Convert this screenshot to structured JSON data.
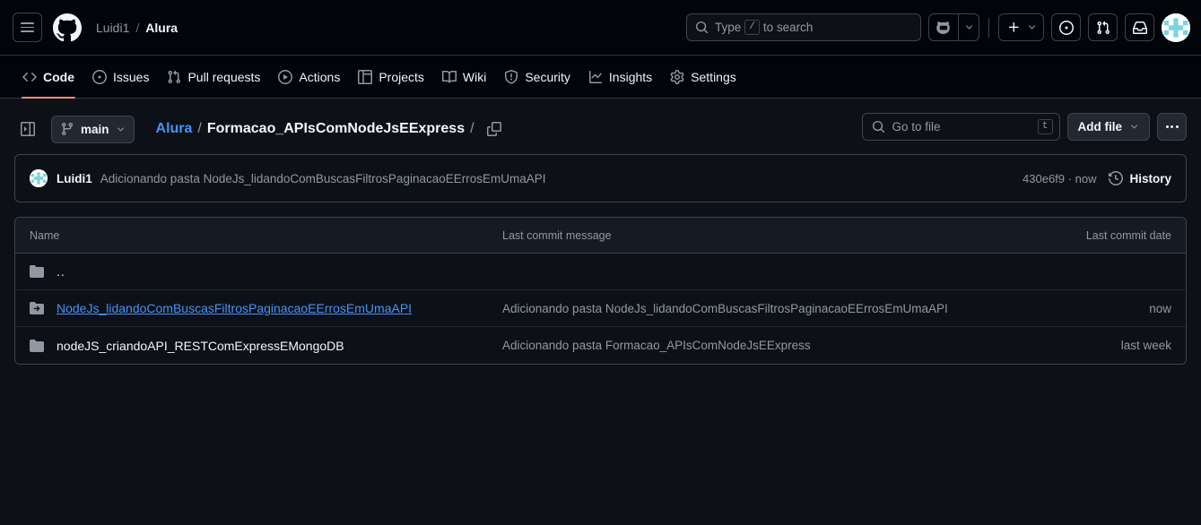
{
  "header": {
    "menu_icon": "hamburger-icon",
    "logo_icon": "github-logo-icon",
    "owner": "Luidi1",
    "separator": "/",
    "repo": "Alura",
    "search": {
      "placeholder_prefix": "Type",
      "kbd": "/",
      "placeholder_suffix": "to search",
      "icon": "search-icon"
    },
    "copilot_icon": "copilot-icon",
    "copilot_caret_icon": "chevron-down-icon",
    "create_new_icon": "plus-icon",
    "create_new_caret_icon": "chevron-down-icon",
    "issues_icon": "issue-opened-icon",
    "pull_requests_icon": "git-pull-request-icon",
    "inbox_icon": "inbox-icon",
    "avatar_icon": "user-avatar"
  },
  "repo_nav": {
    "tabs": [
      {
        "label": "Code",
        "icon": "code-icon",
        "active": true
      },
      {
        "label": "Issues",
        "icon": "issue-opened-icon",
        "active": false
      },
      {
        "label": "Pull requests",
        "icon": "git-pull-request-icon",
        "active": false
      },
      {
        "label": "Actions",
        "icon": "play-icon",
        "active": false
      },
      {
        "label": "Projects",
        "icon": "table-icon",
        "active": false
      },
      {
        "label": "Wiki",
        "icon": "book-icon",
        "active": false
      },
      {
        "label": "Security",
        "icon": "shield-icon",
        "active": false
      },
      {
        "label": "Insights",
        "icon": "graph-icon",
        "active": false
      },
      {
        "label": "Settings",
        "icon": "gear-icon",
        "active": false
      }
    ],
    "active_underline_color": "#fd8c73"
  },
  "browser_bar": {
    "sidebar_toggle_icon": "sidebar-expand-icon",
    "branch": {
      "icon": "git-branch-icon",
      "name": "main",
      "caret_icon": "chevron-down-icon"
    },
    "path": {
      "root": "Alura",
      "sep1": "/",
      "current": "Formacao_APIsComNodeJsEExpress",
      "sep2": "/",
      "copy_icon": "copy-path-icon"
    },
    "go_to_file": {
      "icon": "search-icon",
      "placeholder": "Go to file",
      "kbd": "t"
    },
    "add_file": {
      "label": "Add file",
      "caret_icon": "chevron-down-icon"
    },
    "more_menu_icon": "kebab-horizontal-icon"
  },
  "commit_bar": {
    "avatar_icon": "user-avatar",
    "author": "Luidi1",
    "message": "Adicionando pasta NodeJs_lidandoComBuscasFiltrosPaginacaoEErrosEmUmaAPI",
    "hash": "430e6f9",
    "hash_sep": "·",
    "relative_time": "now",
    "history_icon": "history-icon",
    "history_label": "History"
  },
  "file_table": {
    "columns": {
      "name": "Name",
      "message": "Last commit message",
      "date": "Last commit date"
    },
    "rows": [
      {
        "name": "..",
        "icon": "folder-icon",
        "kind": "updir",
        "message": "",
        "date": ""
      },
      {
        "name": "NodeJs_lidandoComBuscasFiltrosPaginacaoEErrosEmUmaAPI",
        "icon": "folder-symlink-icon",
        "kind": "link",
        "message": "Adicionando pasta NodeJs_lidandoComBuscasFiltrosPaginacaoEErrosEmUmaAPI",
        "date": "now"
      },
      {
        "name": "nodeJS_criandoAPI_RESTComExpressEMongoDB",
        "icon": "folder-icon",
        "kind": "plain",
        "message": "Adicionando pasta Formacao_APIsComNodeJsEExpress",
        "date": "last week"
      }
    ]
  },
  "colors": {
    "page_bg": "#0d1117",
    "header_bg": "#010409",
    "border": "#3d444d",
    "link": "#4493f8",
    "muted": "#9198a1",
    "accent_underline": "#fd8c73"
  }
}
